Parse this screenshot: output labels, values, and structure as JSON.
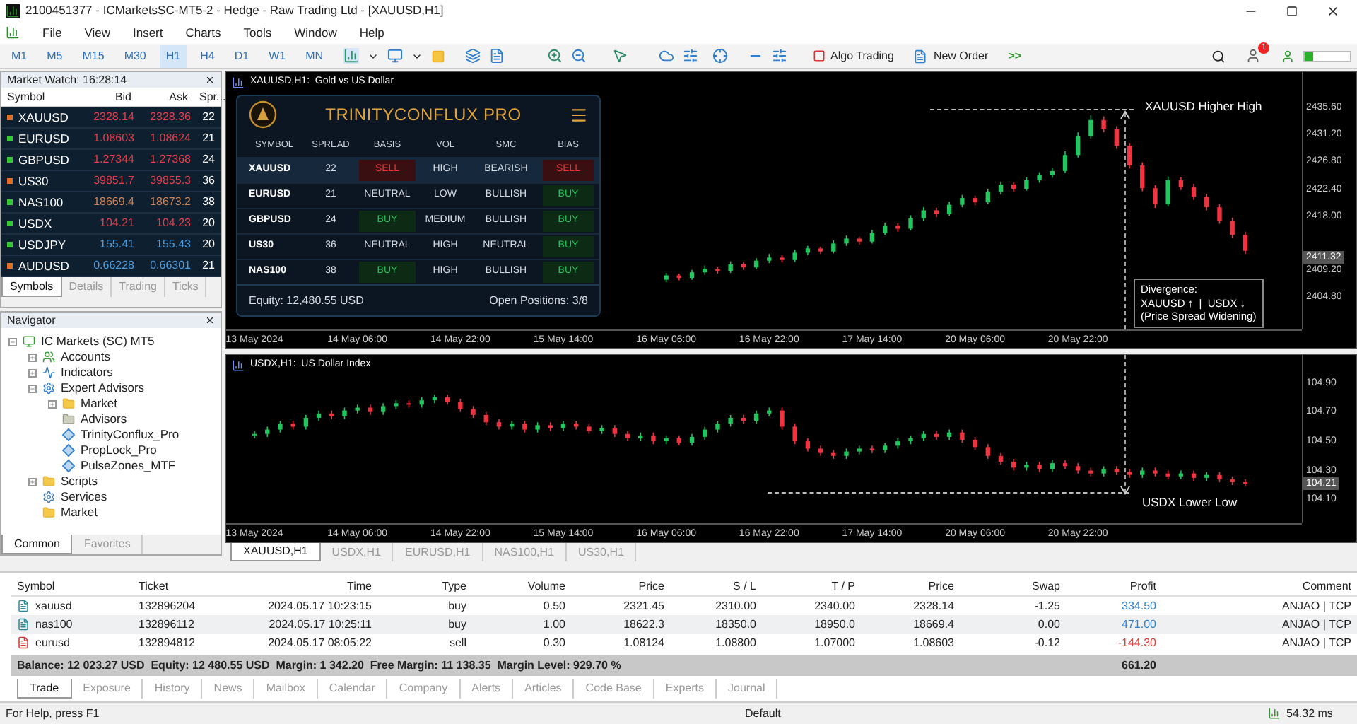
{
  "window": {
    "title": "2100451377 - ICMarketsSC-MT5-2 - Hedge - Raw Trading Ltd - [XAUUSD,H1]"
  },
  "menu": [
    "File",
    "View",
    "Insert",
    "Charts",
    "Tools",
    "Window",
    "Help"
  ],
  "timeframes": [
    {
      "label": "M1",
      "selected": false
    },
    {
      "label": "M5",
      "selected": false
    },
    {
      "label": "M15",
      "selected": false
    },
    {
      "label": "M30",
      "selected": false
    },
    {
      "label": "H1",
      "selected": true
    },
    {
      "label": "H4",
      "selected": false
    },
    {
      "label": "D1",
      "selected": false
    },
    {
      "label": "W1",
      "selected": false
    },
    {
      "label": "MN",
      "selected": false
    }
  ],
  "toolbar": {
    "algo_trading": "Algo Trading",
    "new_order": "New Order",
    "more": ">>",
    "notifications": "1"
  },
  "market_watch": {
    "title": "Market Watch: 16:28:14",
    "columns": [
      "Symbol",
      "Bid",
      "Ask",
      "Spr..."
    ],
    "rows": [
      {
        "symbol": "XAUUSD",
        "bid": "2328.14",
        "ask": "2328.36",
        "spread": "22",
        "color": "#e0404a",
        "marker": {
          "color": "#e0702a"
        }
      },
      {
        "symbol": "EURUSD",
        "bid": "1.08603",
        "ask": "1.08624",
        "spread": "21",
        "color": "#e0404a",
        "marker": {
          "color": "#33cc33"
        }
      },
      {
        "symbol": "GBPUSD",
        "bid": "1.27344",
        "ask": "1.27368",
        "spread": "24",
        "color": "#e0404a",
        "marker": {
          "color": "#33cc33"
        }
      },
      {
        "symbol": "US30",
        "bid": "39851.7",
        "ask": "39855.3",
        "spread": "36",
        "color": "#e0404a",
        "marker": {
          "color": "#e0702a"
        }
      },
      {
        "symbol": "NAS100",
        "bid": "18669.4",
        "ask": "18673.2",
        "spread": "38",
        "color": "#d08050",
        "marker": {
          "color": "#33cc33"
        }
      },
      {
        "symbol": "USDX",
        "bid": "104.21",
        "ask": "104.23",
        "spread": "20",
        "color": "#e0404a",
        "marker": {
          "color": "#33cc33"
        }
      },
      {
        "symbol": "USDJPY",
        "bid": "155.41",
        "ask": "155.43",
        "spread": "20",
        "color": "#4a9ee0",
        "marker": {
          "color": "#33cc33"
        }
      },
      {
        "symbol": "AUDUSD",
        "bid": "0.66228",
        "ask": "0.66301",
        "spread": "21",
        "color": "#4a9ee0",
        "marker": {
          "color": "#e0702a"
        }
      }
    ],
    "tabs": [
      {
        "label": "Symbols",
        "selected": true
      },
      {
        "label": "Details",
        "selected": false
      },
      {
        "label": "Trading",
        "selected": false
      },
      {
        "label": "Ticks",
        "selected": false
      }
    ]
  },
  "navigator": {
    "title": "Navigator",
    "tree": [
      {
        "label": "IC Markets (SC) MT5",
        "kind": "broker",
        "expanded": true,
        "children": [
          {
            "label": "Accounts",
            "kind": "accounts",
            "expanded": false
          },
          {
            "label": "Indicators",
            "kind": "indicators",
            "expanded": false
          },
          {
            "label": "Expert Advisors",
            "kind": "experts",
            "expanded": true,
            "children": [
              {
                "label": "Market",
                "kind": "folder",
                "expanded": false
              },
              {
                "label": "Advisors",
                "kind": "folder-grey"
              },
              {
                "label": "TrinityConflux_Pro",
                "kind": "expert"
              },
              {
                "label": "PropLock_Pro",
                "kind": "expert"
              },
              {
                "label": "PulseZones_MTF",
                "kind": "expert"
              }
            ]
          },
          {
            "label": "Scripts",
            "kind": "folder",
            "expanded": false
          },
          {
            "label": "Services",
            "kind": "services"
          },
          {
            "label": "Market",
            "kind": "folder"
          }
        ]
      }
    ],
    "tabs": [
      {
        "label": "Common",
        "selected": true
      },
      {
        "label": "Favorites",
        "selected": false
      }
    ]
  },
  "charts": [
    {
      "title": "XAUUSD,H1:  Gold vs US Dollar",
      "current_price": "2411.32",
      "chart_data": {
        "type": "candlestick",
        "ylim": [
          2399.5,
          2441.4
        ],
        "yticks": [
          {
            "value": 2435.6,
            "label": "2435.60"
          },
          {
            "value": 2431.2,
            "label": "2431.20"
          },
          {
            "value": 2426.8,
            "label": "2426.80"
          },
          {
            "value": 2422.4,
            "label": "2422.40"
          },
          {
            "value": 2418.0,
            "label": "2418.00"
          },
          {
            "value": 2409.2,
            "label": "2409.20"
          },
          {
            "value": 2404.8,
            "label": "2404.80"
          }
        ],
        "categories": [
          "13 May 2024",
          null,
          null,
          null,
          null,
          null,
          null,
          null,
          "14 May 06:00",
          null,
          null,
          null,
          null,
          null,
          null,
          null,
          "14 May 22:00",
          null,
          null,
          null,
          null,
          null,
          null,
          null,
          "15 May 14:00",
          null,
          null,
          null,
          null,
          null,
          null,
          null,
          "16 May 06:00",
          null,
          null,
          null,
          null,
          null,
          null,
          null,
          "16 May 22:00",
          null,
          null,
          null,
          null,
          null,
          null,
          null,
          "17 May 14:00",
          null,
          null,
          null,
          null,
          null,
          null,
          null,
          "20 May 06:00",
          null,
          null,
          null,
          null,
          null,
          null,
          null,
          "20 May 22:00",
          null,
          null,
          null,
          null,
          null,
          null,
          null,
          null,
          null,
          null,
          null,
          null,
          null
        ],
        "ohlc": [
          null,
          null,
          null,
          null,
          null,
          null,
          null,
          null,
          null,
          null,
          null,
          null,
          null,
          null,
          null,
          null,
          null,
          null,
          null,
          null,
          null,
          null,
          null,
          null,
          null,
          null,
          null,
          null,
          null,
          null,
          null,
          null,
          [
            2407.6,
            2408.7,
            2407.2,
            2408.3
          ],
          [
            2408.3,
            2408.6,
            2407.5,
            2407.9
          ],
          [
            2407.9,
            2409.2,
            2407.6,
            2408.8
          ],
          [
            2408.8,
            2409.9,
            2408.4,
            2409.4
          ],
          [
            2409.4,
            2409.7,
            2408.6,
            2409.0
          ],
          [
            2409.0,
            2410.6,
            2408.7,
            2410.1
          ],
          [
            2410.1,
            2410.4,
            2409.2,
            2409.6
          ],
          [
            2409.6,
            2411.1,
            2409.3,
            2410.7
          ],
          [
            2410.7,
            2411.8,
            2410.3,
            2411.2
          ],
          [
            2411.2,
            2411.6,
            2410.4,
            2410.8
          ],
          [
            2410.8,
            2412.5,
            2410.5,
            2412.0
          ],
          [
            2412.0,
            2413.1,
            2411.6,
            2412.7
          ],
          [
            2412.7,
            2413.0,
            2411.8,
            2412.2
          ],
          [
            2412.2,
            2414.0,
            2411.9,
            2413.5
          ],
          [
            2413.5,
            2414.8,
            2413.1,
            2414.3
          ],
          [
            2414.3,
            2414.6,
            2413.3,
            2413.8
          ],
          [
            2413.8,
            2415.7,
            2413.5,
            2415.2
          ],
          [
            2415.2,
            2416.9,
            2414.8,
            2416.4
          ],
          [
            2416.4,
            2416.8,
            2415.4,
            2415.9
          ],
          [
            2415.9,
            2418.1,
            2415.6,
            2417.6
          ],
          [
            2417.6,
            2419.4,
            2417.2,
            2418.9
          ],
          [
            2418.9,
            2419.3,
            2417.8,
            2418.3
          ],
          [
            2418.3,
            2420.3,
            2418.0,
            2419.8
          ],
          [
            2419.8,
            2421.4,
            2419.4,
            2420.9
          ],
          [
            2420.9,
            2421.3,
            2419.7,
            2420.2
          ],
          [
            2420.2,
            2422.4,
            2419.9,
            2421.9
          ],
          [
            2421.9,
            2423.6,
            2421.5,
            2423.1
          ],
          [
            2423.1,
            2423.5,
            2421.9,
            2422.4
          ],
          [
            2422.4,
            2424.3,
            2422.1,
            2423.8
          ],
          [
            2423.8,
            2425.1,
            2423.4,
            2424.6
          ],
          [
            2424.6,
            2425.8,
            2424.2,
            2425.3
          ],
          [
            2425.3,
            2428.5,
            2425.0,
            2427.9
          ],
          [
            2427.9,
            2431.6,
            2427.5,
            2431.0
          ],
          [
            2431.0,
            2434.4,
            2430.6,
            2433.6
          ],
          [
            2433.6,
            2434.2,
            2431.6,
            2432.1
          ],
          [
            2432.1,
            2432.6,
            2428.9,
            2429.4
          ],
          [
            2429.4,
            2429.9,
            2425.7,
            2426.2
          ],
          [
            2426.2,
            2426.7,
            2422.0,
            2422.5
          ],
          [
            2422.5,
            2423.0,
            2419.3,
            2419.9
          ],
          [
            2419.9,
            2424.4,
            2419.5,
            2423.8
          ],
          [
            2423.8,
            2424.3,
            2422.2,
            2422.7
          ],
          [
            2422.7,
            2423.2,
            2420.6,
            2421.1
          ],
          [
            2421.1,
            2421.6,
            2418.9,
            2419.4
          ],
          [
            2419.4,
            2419.9,
            2416.7,
            2417.2
          ],
          [
            2417.2,
            2417.7,
            2414.4,
            2414.9
          ],
          [
            2414.9,
            2415.4,
            2411.8,
            2412.3
          ]
        ]
      },
      "annotations": [
        {
          "kind": "high",
          "text": "XAUUSD Higher High"
        },
        {
          "kind": "box",
          "lines": [
            "Divergence:",
            "XAUUSD ↑  |  USDX ↓",
            "(Price Spread Widening)"
          ]
        }
      ]
    },
    {
      "title": "USDX,H1:  US Dollar Index",
      "current_price": "104.21",
      "chart_data": {
        "type": "candlestick",
        "ylim": [
          103.94,
          105.09
        ],
        "yticks": [
          {
            "value": 104.9,
            "label": "104.90"
          },
          {
            "value": 104.7,
            "label": "104.70"
          },
          {
            "value": 104.5,
            "label": "104.50"
          },
          {
            "value": 104.3,
            "label": "104.30"
          },
          {
            "value": 104.1,
            "label": "104.10"
          }
        ],
        "categories": [
          "13 May 2024",
          null,
          null,
          null,
          null,
          null,
          null,
          null,
          "14 May 06:00",
          null,
          null,
          null,
          null,
          null,
          null,
          null,
          "14 May 22:00",
          null,
          null,
          null,
          null,
          null,
          null,
          null,
          "15 May 14:00",
          null,
          null,
          null,
          null,
          null,
          null,
          null,
          "16 May 06:00",
          null,
          null,
          null,
          null,
          null,
          null,
          null,
          "16 May 22:00",
          null,
          null,
          null,
          null,
          null,
          null,
          null,
          "17 May 14:00",
          null,
          null,
          null,
          null,
          null,
          null,
          null,
          "20 May 06:00",
          null,
          null,
          null,
          null,
          null,
          null,
          null,
          "20 May 22:00",
          null,
          null,
          null,
          null,
          null,
          null,
          null,
          null,
          null,
          null,
          null,
          null,
          null
        ],
        "ohlc": [
          [
            104.54,
            104.57,
            104.52,
            104.55
          ],
          [
            104.55,
            104.6,
            104.53,
            104.58
          ],
          [
            104.58,
            104.64,
            104.56,
            104.62
          ],
          [
            104.62,
            104.64,
            104.58,
            104.6
          ],
          [
            104.6,
            104.68,
            104.58,
            104.66
          ],
          [
            104.66,
            104.71,
            104.64,
            104.69
          ],
          [
            104.69,
            104.71,
            104.65,
            104.67
          ],
          [
            104.67,
            104.73,
            104.65,
            104.71
          ],
          [
            104.71,
            104.75,
            104.69,
            104.73
          ],
          [
            104.73,
            104.75,
            104.68,
            104.7
          ],
          [
            104.7,
            104.76,
            104.68,
            104.74
          ],
          [
            104.74,
            104.78,
            104.72,
            104.76
          ],
          [
            104.76,
            104.78,
            104.73,
            104.75
          ],
          [
            104.75,
            104.8,
            104.73,
            104.78
          ],
          [
            104.78,
            104.82,
            104.76,
            104.8
          ],
          [
            104.8,
            104.82,
            104.75,
            104.77
          ],
          [
            104.77,
            104.79,
            104.7,
            104.72
          ],
          [
            104.72,
            104.74,
            104.66,
            104.68
          ],
          [
            104.68,
            104.7,
            104.61,
            104.63
          ],
          [
            104.63,
            104.65,
            104.58,
            104.6
          ],
          [
            104.6,
            104.64,
            104.58,
            104.62
          ],
          [
            104.62,
            104.64,
            104.56,
            104.58
          ],
          [
            104.58,
            104.63,
            104.56,
            104.61
          ],
          [
            104.61,
            104.63,
            104.57,
            104.59
          ],
          [
            104.59,
            104.64,
            104.57,
            104.62
          ],
          [
            104.62,
            104.64,
            104.58,
            104.6
          ],
          [
            104.6,
            104.62,
            104.55,
            104.57
          ],
          [
            104.57,
            104.61,
            104.55,
            104.59
          ],
          [
            104.59,
            104.61,
            104.53,
            104.55
          ],
          [
            104.55,
            104.57,
            104.5,
            104.52
          ],
          [
            104.52,
            104.56,
            104.5,
            104.54
          ],
          [
            104.54,
            104.56,
            104.48,
            104.5
          ],
          [
            104.5,
            104.54,
            104.48,
            104.52
          ],
          [
            104.52,
            104.54,
            104.47,
            104.49
          ],
          [
            104.49,
            104.55,
            104.47,
            104.53
          ],
          [
            104.53,
            104.6,
            104.51,
            104.58
          ],
          [
            104.58,
            104.64,
            104.56,
            104.62
          ],
          [
            104.62,
            104.68,
            104.6,
            104.66
          ],
          [
            104.66,
            104.68,
            104.62,
            104.64
          ],
          [
            104.64,
            104.71,
            104.62,
            104.69
          ],
          [
            104.69,
            104.73,
            104.67,
            104.71
          ],
          [
            104.71,
            104.73,
            104.58,
            104.6
          ],
          [
            104.6,
            104.62,
            104.48,
            104.5
          ],
          [
            104.5,
            104.52,
            104.43,
            104.45
          ],
          [
            104.45,
            104.47,
            104.4,
            104.42
          ],
          [
            104.42,
            104.44,
            104.38,
            104.4
          ],
          [
            104.4,
            104.45,
            104.38,
            104.43
          ],
          [
            104.43,
            104.47,
            104.41,
            104.45
          ],
          [
            104.45,
            104.47,
            104.42,
            104.44
          ],
          [
            104.44,
            104.49,
            104.42,
            104.47
          ],
          [
            104.47,
            104.52,
            104.45,
            104.5
          ],
          [
            104.5,
            104.54,
            104.48,
            104.52
          ],
          [
            104.52,
            104.57,
            104.5,
            104.55
          ],
          [
            104.55,
            104.57,
            104.51,
            104.53
          ],
          [
            104.53,
            104.58,
            104.51,
            104.56
          ],
          [
            104.56,
            104.58,
            104.49,
            104.51
          ],
          [
            104.51,
            104.53,
            104.44,
            104.46
          ],
          [
            104.46,
            104.48,
            104.38,
            104.4
          ],
          [
            104.4,
            104.42,
            104.34,
            104.36
          ],
          [
            104.36,
            104.38,
            104.3,
            104.32
          ],
          [
            104.32,
            104.36,
            104.3,
            104.34
          ],
          [
            104.34,
            104.36,
            104.29,
            104.31
          ],
          [
            104.31,
            104.37,
            104.29,
            104.35
          ],
          [
            104.35,
            104.37,
            104.31,
            104.33
          ],
          [
            104.33,
            104.35,
            104.28,
            104.3
          ],
          [
            104.3,
            104.32,
            104.26,
            104.28
          ],
          [
            104.28,
            104.33,
            104.26,
            104.31
          ],
          [
            104.31,
            104.33,
            104.27,
            104.29
          ],
          [
            104.29,
            104.31,
            104.25,
            104.27
          ],
          [
            104.27,
            104.32,
            104.25,
            104.3
          ],
          [
            104.3,
            104.32,
            104.26,
            104.28
          ],
          [
            104.28,
            104.3,
            104.24,
            104.26
          ],
          [
            104.26,
            104.3,
            104.24,
            104.28
          ],
          [
            104.28,
            104.3,
            104.23,
            104.25
          ],
          [
            104.25,
            104.29,
            104.23,
            104.27
          ],
          [
            104.27,
            104.29,
            104.22,
            104.24
          ],
          [
            104.24,
            104.26,
            104.2,
            104.22
          ],
          [
            104.22,
            104.24,
            104.19,
            104.21
          ]
        ]
      },
      "annotations": [
        {
          "kind": "low",
          "text": "USDX Lower Low"
        }
      ]
    }
  ],
  "panel": {
    "title": "TRINITYCONFLUX PRO",
    "columns": [
      "SYMBOL",
      "SPREAD",
      "BASIS",
      "VOL",
      "SMC",
      "BIAS"
    ],
    "rows": [
      {
        "symbol": "XAUUSD",
        "spread": "22",
        "basis": {
          "text": "SELL",
          "kind": "sell"
        },
        "vol": "HIGH",
        "smc": "BEARISH",
        "bias": {
          "text": "SELL",
          "kind": "sell"
        },
        "selected": true
      },
      {
        "symbol": "EURUSD",
        "spread": "21",
        "basis": {
          "text": "NEUTRAL",
          "kind": "neutral"
        },
        "vol": "LOW",
        "smc": "BULLISH",
        "bias": {
          "text": "BUY",
          "kind": "buy"
        },
        "selected": false
      },
      {
        "symbol": "GBPUSD",
        "spread": "24",
        "basis": {
          "text": "BUY",
          "kind": "buy"
        },
        "vol": "MEDIUM",
        "smc": "BULLISH",
        "bias": {
          "text": "BUY",
          "kind": "buy"
        },
        "selected": false
      },
      {
        "symbol": "US30",
        "spread": "36",
        "basis": {
          "text": "NEUTRAL",
          "kind": "neutral"
        },
        "vol": "HIGH",
        "smc": "NEUTRAL",
        "bias": {
          "text": "BUY",
          "kind": "buy"
        },
        "selected": false
      },
      {
        "symbol": "NAS100",
        "spread": "38",
        "basis": {
          "text": "BUY",
          "kind": "buy"
        },
        "vol": "HIGH",
        "smc": "BULLISH",
        "bias": {
          "text": "BUY",
          "kind": "buy"
        },
        "selected": false
      }
    ],
    "equity": "Equity: 12,480.55 USD",
    "positions": "Open Positions: 3/8"
  },
  "chart_tabs": [
    {
      "label": "XAUUSD,H1",
      "selected": true
    },
    {
      "label": "USDX,H1",
      "selected": false
    },
    {
      "label": "EURUSD,H1",
      "selected": false
    },
    {
      "label": "NAS100,H1",
      "selected": false
    },
    {
      "label": "US30,H1",
      "selected": false
    }
  ],
  "trade": {
    "columns": [
      "Symbol",
      "Ticket",
      "Time",
      "Type",
      "Volume",
      "Price",
      "S / L",
      "T / P",
      "Price",
      "Swap",
      "Profit",
      "Comment"
    ],
    "rows": [
      {
        "kind": "buy",
        "cells": [
          "xauusd",
          "132896204",
          "2024.05.17 10:23:15",
          "buy",
          "0.50",
          "2321.45",
          "2310.00",
          "2340.00",
          "2328.14",
          "-1.25",
          "334.50",
          "ANJAO | TCP"
        ],
        "color": "#2f7fd0"
      },
      {
        "kind": "buy",
        "cells": [
          "nas100",
          "132896112",
          "2024.05.17 10:25:11",
          "buy",
          "1.00",
          "18622.3",
          "18350.0",
          "18950.0",
          "18669.4",
          "0.00",
          "471.00",
          "ANJAO | TCP"
        ],
        "color": "#2f7fd0"
      },
      {
        "kind": "sell",
        "cells": [
          "eurusd",
          "132894812",
          "2024.05.17 08:05:22",
          "sell",
          "0.30",
          "1.08124",
          "1.08800",
          "1.07000",
          "1.08603",
          "-0.12",
          "-144.30",
          "ANJAO | TCP"
        ],
        "color": "#e53935"
      }
    ],
    "summary": "Balance: 12 023.27 USD  Equity: 12 480.55 USD  Margin: 1 342.20  Free Margin: 11 138.35  Margin Level: 929.70 %",
    "total": "661.20",
    "tabs": [
      {
        "label": "Trade",
        "selected": true
      },
      {
        "label": "Exposure",
        "selected": false
      },
      {
        "label": "History",
        "selected": false
      },
      {
        "label": "News",
        "selected": false
      },
      {
        "label": "Mailbox",
        "selected": false
      },
      {
        "label": "Calendar",
        "selected": false
      },
      {
        "label": "Company",
        "selected": false
      },
      {
        "label": "Alerts",
        "selected": false
      },
      {
        "label": "Articles",
        "selected": false
      },
      {
        "label": "Code Base",
        "selected": false
      },
      {
        "label": "Experts",
        "selected": false
      },
      {
        "label": "Journal",
        "selected": false
      }
    ]
  },
  "status_bar": {
    "help": "For Help, press F1",
    "profile": "Default",
    "ping": "54.32 ms"
  }
}
